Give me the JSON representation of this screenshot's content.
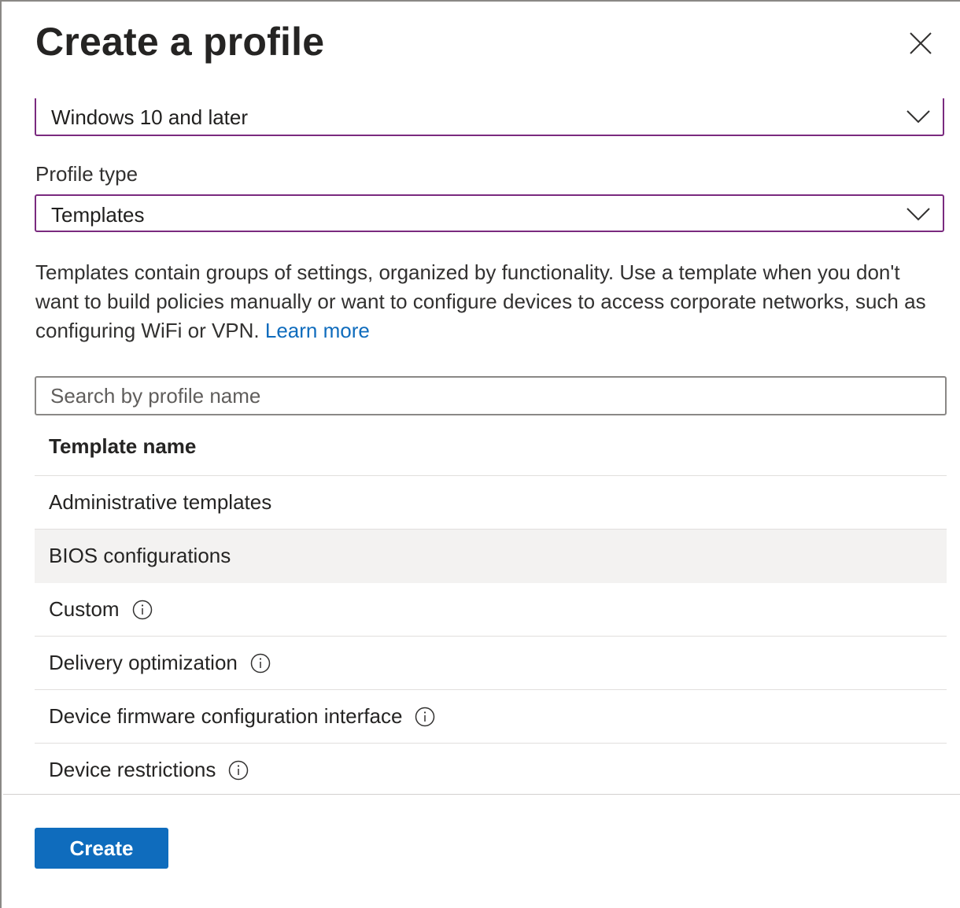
{
  "panel": {
    "title": "Create a profile"
  },
  "platform": {
    "value": "Windows 10 and later"
  },
  "profile_type": {
    "label": "Profile type",
    "value": "Templates"
  },
  "description": {
    "text": "Templates contain groups of settings, organized by functionality. Use a template when you don't want to build policies manually or want to configure devices to access corporate networks, such as configuring WiFi or VPN. ",
    "link": "Learn more"
  },
  "search": {
    "placeholder": "Search by profile name"
  },
  "table": {
    "header": "Template name",
    "rows": [
      {
        "name": "Administrative templates",
        "info": false,
        "selected": false
      },
      {
        "name": "BIOS configurations",
        "info": false,
        "selected": true
      },
      {
        "name": "Custom",
        "info": true,
        "selected": false
      },
      {
        "name": "Delivery optimization",
        "info": true,
        "selected": false
      },
      {
        "name": "Device firmware configuration interface",
        "info": true,
        "selected": false
      },
      {
        "name": "Device restrictions",
        "info": true,
        "selected": false
      }
    ]
  },
  "footer": {
    "create_label": "Create"
  },
  "colors": {
    "accent": "#0f6cbd",
    "dropdown_border": "#7a2a7f",
    "selected_row": "#f3f2f1"
  },
  "icons": {
    "close": "close-icon",
    "chevron": "chevron-down-icon",
    "info": "info-icon"
  }
}
